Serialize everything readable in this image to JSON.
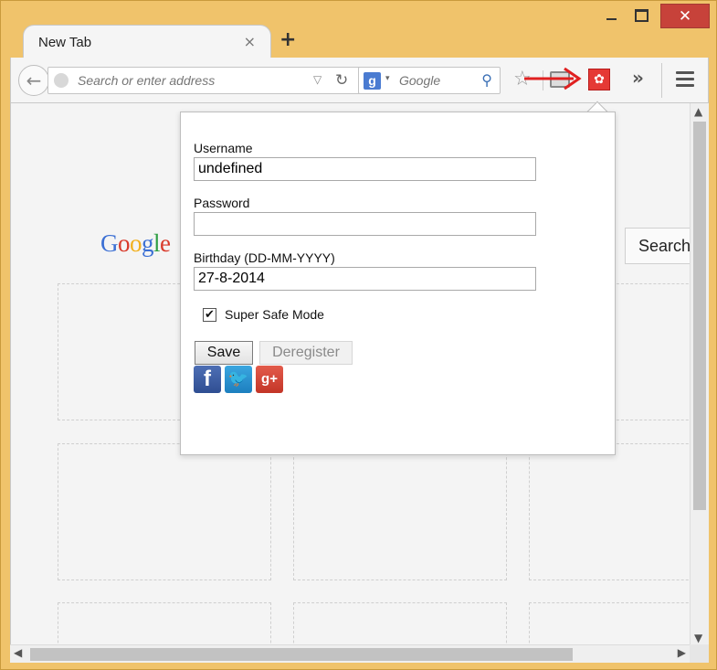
{
  "window": {
    "tab_title": "New Tab",
    "tab_close": "×",
    "new_tab": "+",
    "close_glyph": "✕"
  },
  "navbar": {
    "back_glyph": "←",
    "url_placeholder": "Search or enter address",
    "url_dropdown": "▽",
    "reload_glyph": "↻",
    "search_engine_letter": "g",
    "search_engine_dropdown": "▾",
    "search_placeholder": "Google",
    "search_glyph": "⚲",
    "star_glyph": "☆",
    "extension_glyph": "✿",
    "overflow_glyph": "»"
  },
  "page": {
    "google_logo": [
      {
        "ch": "G",
        "color": "#3b6fd4"
      },
      {
        "ch": "o",
        "color": "#d93a2b"
      },
      {
        "ch": "o",
        "color": "#f2b01e"
      },
      {
        "ch": "g",
        "color": "#3b6fd4"
      },
      {
        "ch": "l",
        "color": "#2f9e44"
      },
      {
        "ch": "e",
        "color": "#d93a2b"
      }
    ],
    "search_button": "Search"
  },
  "scrollbars": {
    "up": "▲",
    "down": "▼",
    "left": "◀",
    "right": "▶"
  },
  "popup": {
    "username_label": "Username",
    "username_value": "undefined",
    "password_label": "Password",
    "password_value": "",
    "birthday_label": "Birthday (DD-MM-YYYY)",
    "birthday_value": "27-8-2014",
    "super_safe_label": "Super Safe Mode",
    "super_safe_checked": true,
    "check_glyph": "✔",
    "save_label": "Save",
    "deregister_label": "Deregister",
    "facebook_glyph": "f",
    "twitter_glyph": "🐦",
    "googleplus_glyph": "g+"
  },
  "colors": {
    "window_frame": "#f0c36b",
    "close_button": "#c7423a",
    "annotation_arrow": "#e02020",
    "extension_icon": "#e53935"
  }
}
